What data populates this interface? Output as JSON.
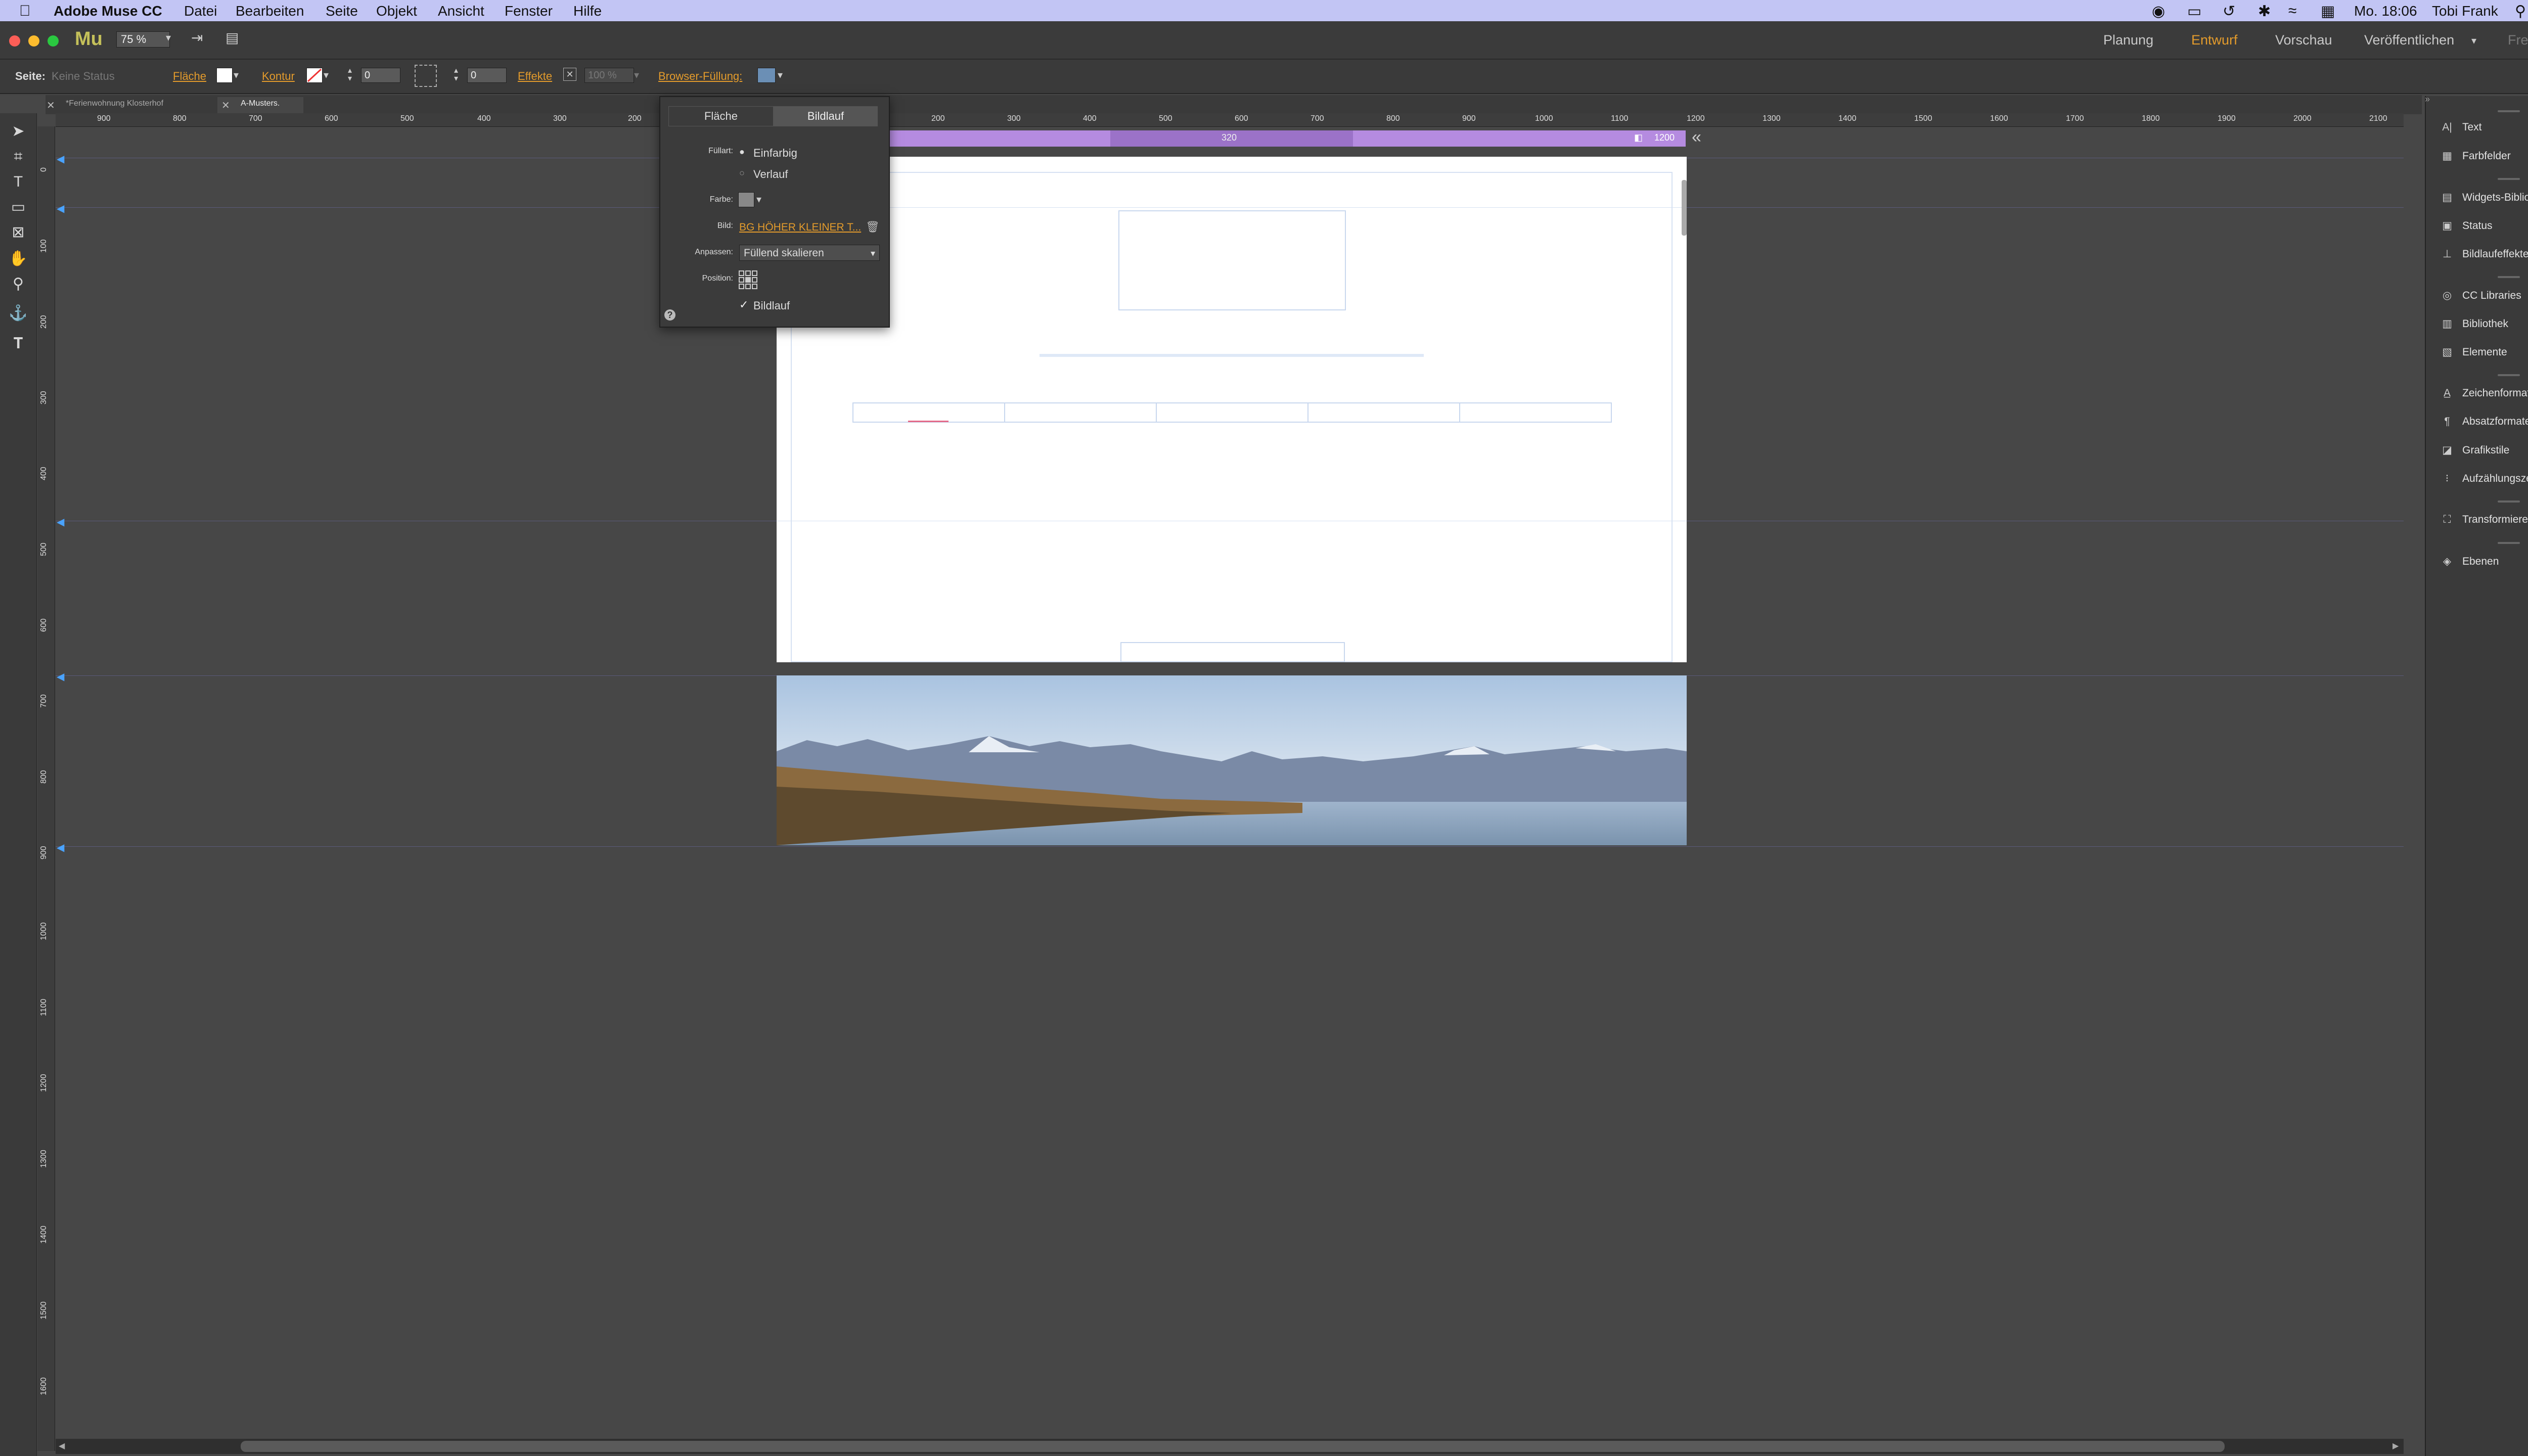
{
  "menubar": {
    "app_name": "Adobe Muse CC",
    "items": [
      "Datei",
      "Bearbeiten",
      "Seite",
      "Objekt",
      "Ansicht",
      "Fenster",
      "Hilfe"
    ],
    "clock": "Mo. 18:06",
    "user": "Tobi Frank"
  },
  "app": {
    "logo": "Mu",
    "zoom": "75 %",
    "modes": [
      "Planung",
      "Entwurf",
      "Vorschau",
      "Veröffentlichen",
      "Freigeben"
    ],
    "active_mode": "Entwurf"
  },
  "controlbar": {
    "seite_label": "Seite:",
    "seite_value": "Keine Status",
    "flaeche_label": "Fläche",
    "kontur_label": "Kontur",
    "kontur_value": "0",
    "corner_value": "0",
    "effekte_label": "Effekte",
    "opacity_value": "100 %",
    "browser_fill_label": "Browser-Füllung:"
  },
  "tabs": [
    {
      "label": "*Ferienwohnung Klosterhof",
      "active": false
    },
    {
      "label": "A-Musters.",
      "active": true
    }
  ],
  "ruler": {
    "h_ticks": [
      "900",
      "800",
      "700",
      "600",
      "500",
      "400",
      "300",
      "200",
      "200",
      "300",
      "400",
      "500",
      "600",
      "700",
      "800",
      "900",
      "1000",
      "1100",
      "1200",
      "1300",
      "1400",
      "1500",
      "1600",
      "1700",
      "1800",
      "1900",
      "2000",
      "2100"
    ],
    "v_ticks": [
      "0",
      "100",
      "200",
      "300",
      "400",
      "500",
      "600",
      "700",
      "800",
      "900",
      "1000",
      "1100",
      "1200",
      "1300",
      "1400",
      "1500",
      "1600",
      "1700",
      "1800"
    ]
  },
  "breakpoint": {
    "mid_label": "320",
    "end_label": "1200"
  },
  "popup": {
    "tabs": [
      "Fläche",
      "Bildlauf"
    ],
    "active_tab": "Bildlauf",
    "fuellart_label": "Füllart:",
    "fuellart_options": [
      "Einfarbig",
      "Verlauf"
    ],
    "fuellart_selected": "Einfarbig",
    "farbe_label": "Farbe:",
    "bild_label": "Bild:",
    "bild_value": "BG HÖHER KLEINER T...",
    "anpassen_label": "Anpassen:",
    "anpassen_value": "Füllend skalieren",
    "position_label": "Position:",
    "bildlauf_checkbox": "Bildlauf",
    "bildlauf_checked": true,
    "help": "?"
  },
  "panels": [
    {
      "label": "Text",
      "icon": "text-icon"
    },
    {
      "label": "Farbfelder",
      "icon": "swatches-icon"
    },
    {
      "label": "Widgets-Bibliothek",
      "icon": "widgets-icon"
    },
    {
      "label": "Status",
      "icon": "states-icon"
    },
    {
      "label": "Bildlaufeffekte",
      "icon": "scroll-effects-icon"
    },
    {
      "label": "CC Libraries",
      "icon": "cc-libraries-icon"
    },
    {
      "label": "Bibliothek",
      "icon": "library-icon"
    },
    {
      "label": "Elemente",
      "icon": "assets-icon"
    },
    {
      "label": "Zeichenformate",
      "icon": "character-styles-icon"
    },
    {
      "label": "Absatzformate",
      "icon": "paragraph-styles-icon"
    },
    {
      "label": "Grafikstile",
      "icon": "graphic-styles-icon"
    },
    {
      "label": "Aufzählungszeiche...",
      "icon": "bullet-styles-icon"
    },
    {
      "label": "Transformieren",
      "icon": "transform-icon"
    },
    {
      "label": "Ebenen",
      "icon": "layers-icon"
    }
  ]
}
